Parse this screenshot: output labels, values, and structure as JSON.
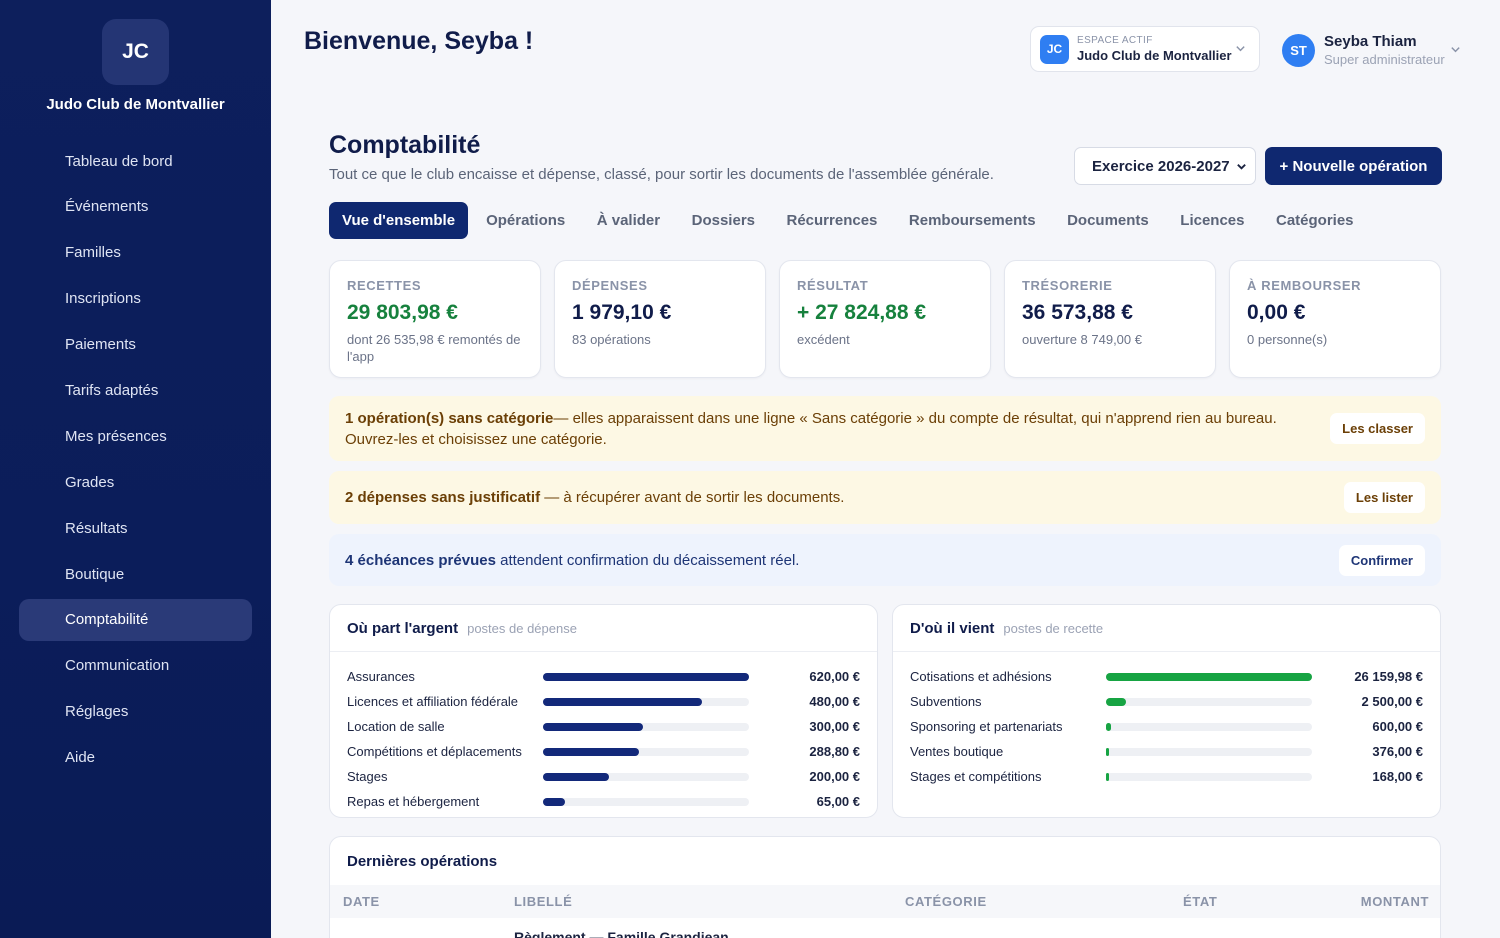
{
  "sidebar": {
    "logo_initials": "JC",
    "club_name": "Judo Club de Montvallier",
    "items": [
      {
        "label": "Tableau de bord",
        "icon": "home-icon"
      },
      {
        "label": "Événements",
        "icon": "calendar-icon"
      },
      {
        "label": "Familles",
        "icon": "users-icon"
      },
      {
        "label": "Inscriptions",
        "icon": "clipboard-icon"
      },
      {
        "label": "Paiements",
        "icon": "credit-card-icon"
      },
      {
        "label": "Tarifs adaptés",
        "icon": "tag-icon"
      },
      {
        "label": "Mes présences",
        "icon": "check-square-icon"
      },
      {
        "label": "Grades",
        "icon": "award-icon"
      },
      {
        "label": "Résultats",
        "icon": "trophy-icon"
      },
      {
        "label": "Boutique",
        "icon": "shopping-bag-icon"
      },
      {
        "label": "Comptabilité",
        "icon": "ledger-icon",
        "active": true
      },
      {
        "label": "Communication",
        "icon": "mail-icon"
      },
      {
        "label": "Réglages",
        "icon": "gear-icon"
      },
      {
        "label": "Aide",
        "icon": "book-icon"
      }
    ]
  },
  "header": {
    "welcome": "Bienvenue, Seyba !",
    "space_label": "ESPACE ACTIF",
    "space_name": "Judo Club de Montvallier",
    "space_initials": "JC",
    "user_initials": "ST",
    "user_name": "Seyba Thiam",
    "user_role": "Super administrateur"
  },
  "page": {
    "title": "Comptabilité",
    "subtitle": "Tout ce que le club encaisse et dépense, classé, pour sortir les documents de l'assemblée générale.",
    "exercice": "Exercice 2026-2027",
    "new_operation": "+ Nouvelle opération"
  },
  "tabs": [
    {
      "label": "Vue d'ensemble",
      "active": true
    },
    {
      "label": "Opérations"
    },
    {
      "label": "À valider"
    },
    {
      "label": "Dossiers"
    },
    {
      "label": "Récurrences"
    },
    {
      "label": "Remboursements"
    },
    {
      "label": "Documents"
    },
    {
      "label": "Licences"
    },
    {
      "label": "Catégories"
    }
  ],
  "kpis": [
    {
      "label": "RECETTES",
      "value": "29 803,98 €",
      "note": "dont 26 535,98 € remontés de l'app",
      "green": true
    },
    {
      "label": "DÉPENSES",
      "value": "1 979,10 €",
      "note": "83 opérations"
    },
    {
      "label": "RÉSULTAT",
      "value": "+ 27 824,88 €",
      "note": "excédent",
      "green": true
    },
    {
      "label": "TRÉSORERIE",
      "value": "36 573,88 €",
      "note": "ouverture 8 749,00 €"
    },
    {
      "label": "À REMBOURSER",
      "value": "0,00 €",
      "note": "0 personne(s)"
    }
  ],
  "alerts": {
    "uncategorized_bold": "1 opération(s) sans catégorie",
    "uncategorized_text": "— elles apparaissent dans une ligne « Sans catégorie » du compte de résultat, qui n'apprend rien au bureau. Ouvrez-les et choisissez une catégorie.",
    "uncategorized_btn": "Les classer",
    "receipts_bold": "2 dépenses sans justificatif",
    "receipts_text": " — à récupérer avant de sortir les documents.",
    "receipts_btn": "Les lister",
    "due_bold": "4 échéances prévues",
    "due_text": " attendent confirmation du décaissement réel.",
    "due_btn": "Confirmer"
  },
  "expenses_panel": {
    "title": "Où part l'argent",
    "subtitle": "postes de dépense",
    "color": "#13297a",
    "rows": [
      {
        "label": "Assurances",
        "value": "620,00 €",
        "amount": 620
      },
      {
        "label": "Licences et affiliation fédérale",
        "value": "480,00 €",
        "amount": 480
      },
      {
        "label": "Location de salle",
        "value": "300,00 €",
        "amount": 300
      },
      {
        "label": "Compétitions et déplacements",
        "value": "288,80 €",
        "amount": 288.8
      },
      {
        "label": "Stages",
        "value": "200,00 €",
        "amount": 200
      },
      {
        "label": "Repas et hébergement",
        "value": "65,00 €",
        "amount": 65
      }
    ]
  },
  "income_panel": {
    "title": "D'où il vient",
    "subtitle": "postes de recette",
    "color": "#17a443",
    "rows": [
      {
        "label": "Cotisations et adhésions",
        "value": "26 159,98 €",
        "amount": 26159.98
      },
      {
        "label": "Subventions",
        "value": "2 500,00 €",
        "amount": 2500
      },
      {
        "label": "Sponsoring et partenariats",
        "value": "600,00 €",
        "amount": 600
      },
      {
        "label": "Ventes boutique",
        "value": "376,00 €",
        "amount": 376
      },
      {
        "label": "Stages et compétitions",
        "value": "168,00 €",
        "amount": 168
      }
    ]
  },
  "operations": {
    "title": "Dernières opérations",
    "columns": [
      "DATE",
      "LIBELLÉ",
      "CATÉGORIE",
      "ÉTAT",
      "MONTANT"
    ],
    "first_row_label": "Règlement — Famille Grandjean"
  }
}
